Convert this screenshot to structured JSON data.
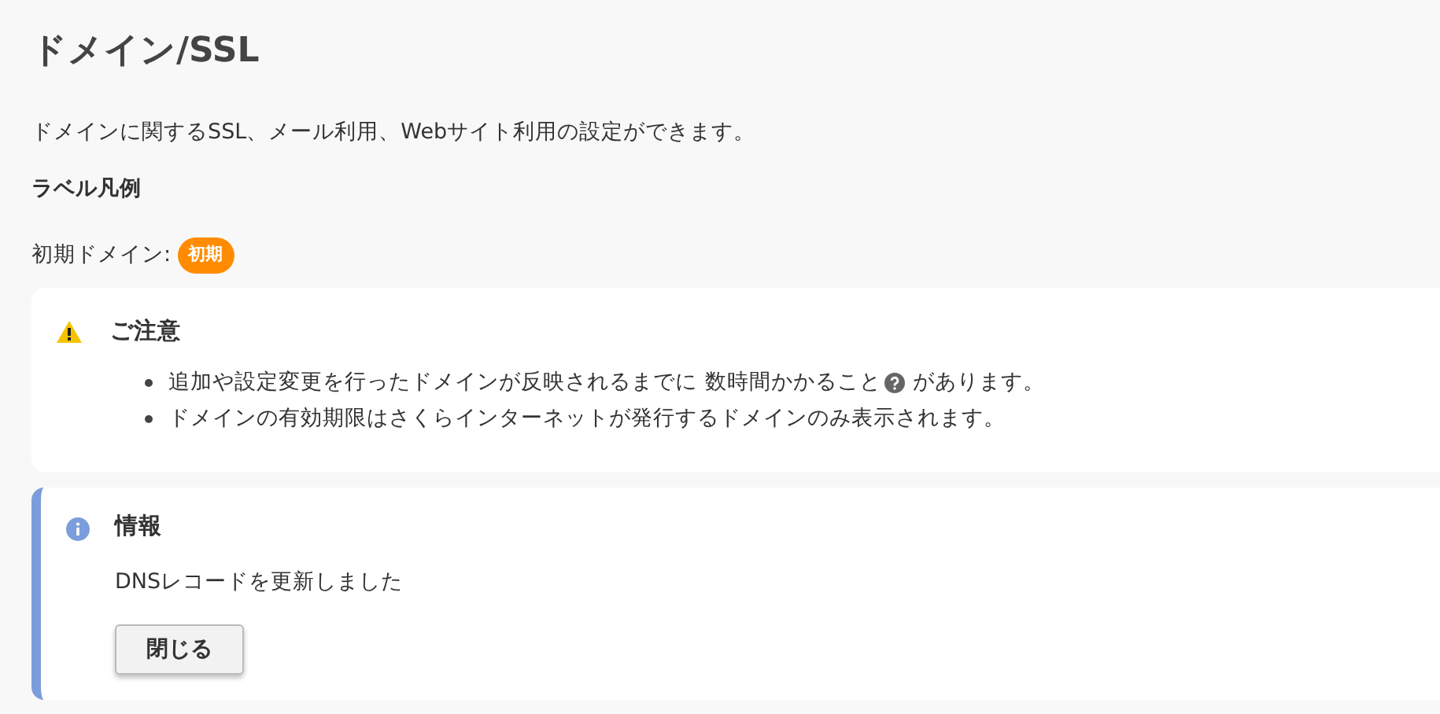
{
  "page_title": "ドメイン/SSL",
  "description": "ドメインに関するSSL、メール利用、Webサイト利用の設定ができます。",
  "legend": {
    "heading": "ラベル凡例",
    "label": "初期ドメイン:",
    "badge": "初期"
  },
  "notice": {
    "title": "ご注意",
    "items": [
      {
        "text": "追加や設定変更を行ったドメインが反映されるまでに",
        "link": "数時間かかること",
        "after": "があります。"
      },
      {
        "text": "ドメインの有効期限はさくらインターネットが発行するドメインのみ表示されます。"
      }
    ]
  },
  "info": {
    "title": "情報",
    "message": "DNSレコードを更新しました",
    "button": "閉じる"
  }
}
